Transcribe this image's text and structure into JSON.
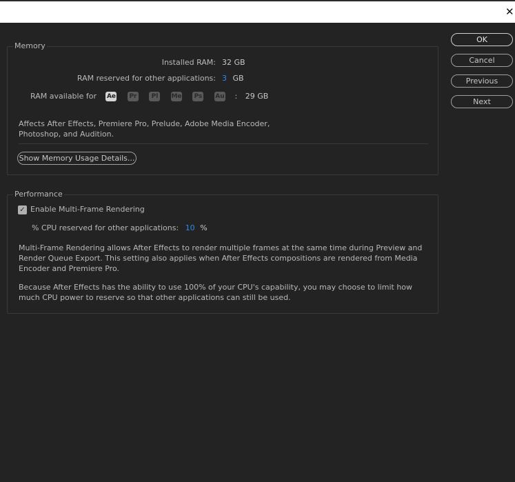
{
  "window": {
    "close_glyph": "✕"
  },
  "memory": {
    "legend": "Memory",
    "installed_ram_label": "Installed RAM:",
    "installed_ram_value": "32 GB",
    "reserved_label": "RAM reserved for other applications:",
    "reserved_value": "3",
    "reserved_unit": "GB",
    "available_label": "RAM available for",
    "apps": [
      "Ae",
      "Pr",
      "Pl",
      "Me",
      "Ps",
      "Au"
    ],
    "available_separator": ":",
    "available_value": "29 GB",
    "description_line1": "Affects After Effects, Premiere Pro, Prelude, Adobe Media Encoder,",
    "description_line2": "Photoshop, and Audition.",
    "details_button": "Show Memory Usage Details..."
  },
  "performance": {
    "legend": "Performance",
    "mfr_checkbox_label": "Enable Multi-Frame Rendering",
    "mfr_checked": true,
    "check_glyph": "✓",
    "cpu_label": "% CPU reserved for other applications:",
    "cpu_value": "10",
    "cpu_unit": "%",
    "desc1_line1": "Multi-Frame Rendering allows After Effects to render multiple frames at the same time during Preview and",
    "desc1_line2": "Render Queue Export. This setting also applies when After Effects compositions are rendered from Media",
    "desc1_line3": "Encoder and Premiere Pro.",
    "desc2_line1": "Because After Effects has the ability to use 100% of your CPU's capability, you may choose to limit how",
    "desc2_line2": "much CPU power to reserve so that other applications can still be used."
  },
  "buttons": {
    "ok": "OK",
    "cancel": "Cancel",
    "previous": "Previous",
    "next": "Next"
  },
  "colors": {
    "background": "#232323",
    "accent_blue": "#2d8ceb",
    "text": "#c8c8c8"
  }
}
